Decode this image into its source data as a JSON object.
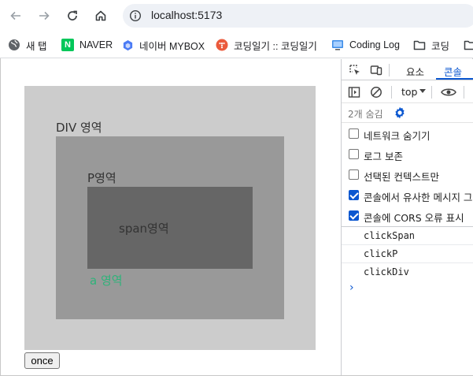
{
  "browser": {
    "url": "localhost:5173",
    "bookmarks": [
      {
        "label": "새 탭",
        "icon": "globe-icon"
      },
      {
        "label": "NAVER",
        "icon": "naver-icon",
        "icon_text": "N",
        "icon_color": "#03c75a"
      },
      {
        "label": "네이버 MYBOX",
        "icon": "mybox-icon",
        "icon_color": "#4b7bf5"
      },
      {
        "label": "코딩일기 :: 코딩일기",
        "icon": "tistory-icon",
        "icon_color": "#eb5a3c"
      },
      {
        "label": "Coding Log",
        "icon": "monitor-icon",
        "icon_color": "#3c8ce7"
      },
      {
        "label": "코딩",
        "icon": "folder-icon"
      }
    ]
  },
  "page": {
    "div_label": "DIV 영역",
    "p_label": "P영역",
    "span_label": "span영역",
    "a_label": "a 영역",
    "once_button": "once",
    "colors": {
      "div_bg": "#cccccc",
      "p_bg": "#999999",
      "span_bg": "#666666",
      "link": "#2fb37a"
    }
  },
  "devtools": {
    "tabs": [
      "요소",
      "콘솔"
    ],
    "active_tab": "콘솔",
    "context": "top",
    "hidden_count": "2개 숨김",
    "options": [
      {
        "label": "네트워크 숨기기",
        "checked": false
      },
      {
        "label": "로그 보존",
        "checked": false
      },
      {
        "label": "선택된 컨텍스트만",
        "checked": false
      },
      {
        "label": "콘솔에서 유사한 메시지 그",
        "checked": true
      },
      {
        "label": "콘솔에 CORS 오류 표시",
        "checked": true
      }
    ],
    "logs": [
      "clickSpan",
      "clickP",
      "clickDiv"
    ],
    "prompt": "›"
  }
}
